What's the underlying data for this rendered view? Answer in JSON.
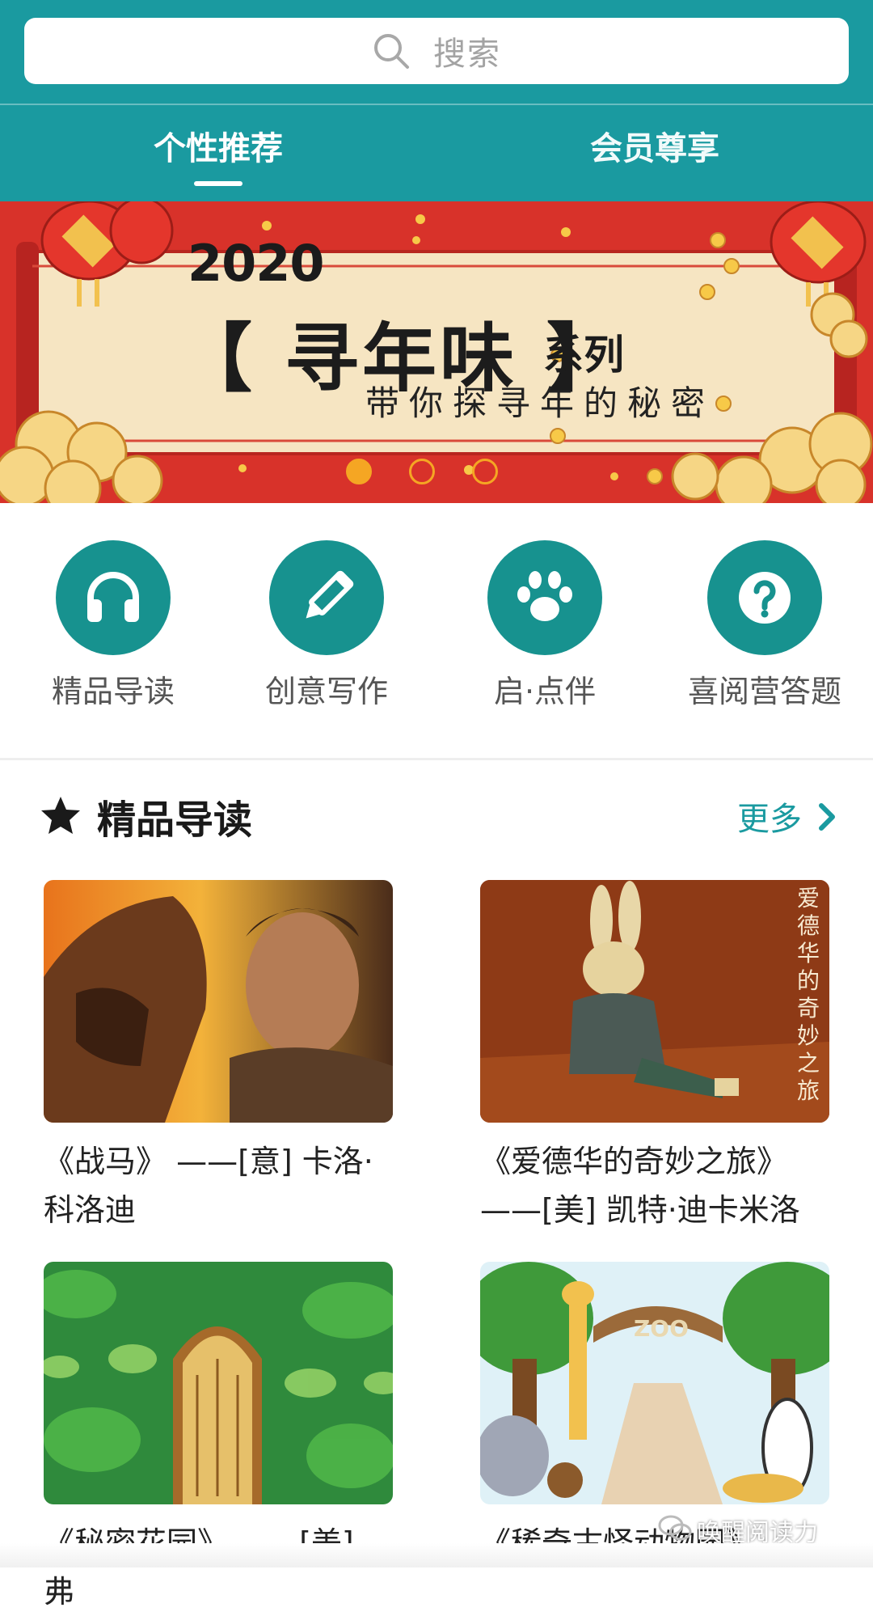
{
  "search": {
    "placeholder": "搜索",
    "icon": "search-icon"
  },
  "tabs": [
    {
      "label": "个性推荐",
      "active": true
    },
    {
      "label": "会员尊享",
      "active": false
    }
  ],
  "banner": {
    "year": "2020",
    "title": "【 寻年味 】",
    "series": "系列",
    "subtitle": "带你探寻年的秘密",
    "slide_count": 3,
    "active_slide": 1
  },
  "categories": [
    {
      "label": "精品导读",
      "icon": "headphones-icon"
    },
    {
      "label": "创意写作",
      "icon": "pencil-icon"
    },
    {
      "label": "启·点伴",
      "icon": "paw-icon"
    },
    {
      "label": "喜阅营答题",
      "icon": "question-icon"
    }
  ],
  "section": {
    "title": "精品导读",
    "more": "更多",
    "icon": "star-icon"
  },
  "books": [
    {
      "caption": "《战马》 ——[意] 卡洛·科洛迪"
    },
    {
      "caption": "《爱德华的奇妙之旅》 ——[美] 凯特·迪卡米洛",
      "cover_text": "爱德华的奇妙之旅"
    },
    {
      "caption": "《秘密花园》 ——[美] 弗"
    },
    {
      "caption": "《稀奇古怪动物园》 ——"
    }
  ],
  "watermark": "唤醒阅读力",
  "colors": {
    "primary": "#1a9aa0",
    "icon_circle": "#17928f",
    "banner_red": "#d5332b",
    "dot": "#f5a623"
  }
}
